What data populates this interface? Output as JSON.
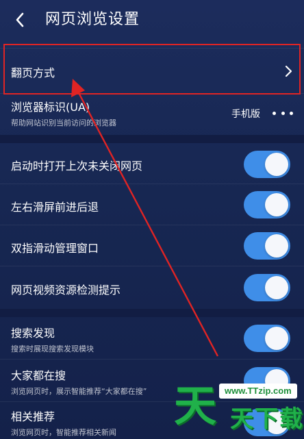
{
  "header": {
    "title": "网页浏览设置",
    "back_icon": "chevron-left-icon"
  },
  "rows": {
    "page_turn": {
      "label": "翻页方式",
      "icon": "chevron-right-icon"
    },
    "ua": {
      "label": "浏览器标识(UA)",
      "sub": "帮助网站识别当前访问的浏览器",
      "value": "手机版",
      "icon": "more-dots-icon"
    },
    "restore_tabs": {
      "label": "启动时打开上次未关闭网页",
      "enabled": true
    },
    "swipe_nav": {
      "label": "左右滑屏前进后退",
      "enabled": true
    },
    "two_finger": {
      "label": "双指滑动管理窗口",
      "enabled": true
    },
    "video_detect": {
      "label": "网页视频资源检测提示",
      "enabled": true
    },
    "search_discover": {
      "label": "搜索发现",
      "sub": "搜索时展现搜索发现模块",
      "enabled": true
    },
    "trending": {
      "label": "大家都在搜",
      "sub": "浏览网页时，展示智能推荐“大家都在搜”",
      "enabled": true
    },
    "related": {
      "label": "相关推荐",
      "sub": "浏览网页时，智能推荐相关新闻",
      "enabled": true
    }
  },
  "annotation": {
    "highlight_color": "#e02424"
  },
  "watermark": {
    "url": "www.TTzip.com",
    "big_char": "天",
    "small_text": "天下载"
  },
  "colors": {
    "background": "#172752",
    "toggle_on": "#3f8ee8",
    "knob": "#f5f7fb",
    "text": "#ffffff"
  }
}
